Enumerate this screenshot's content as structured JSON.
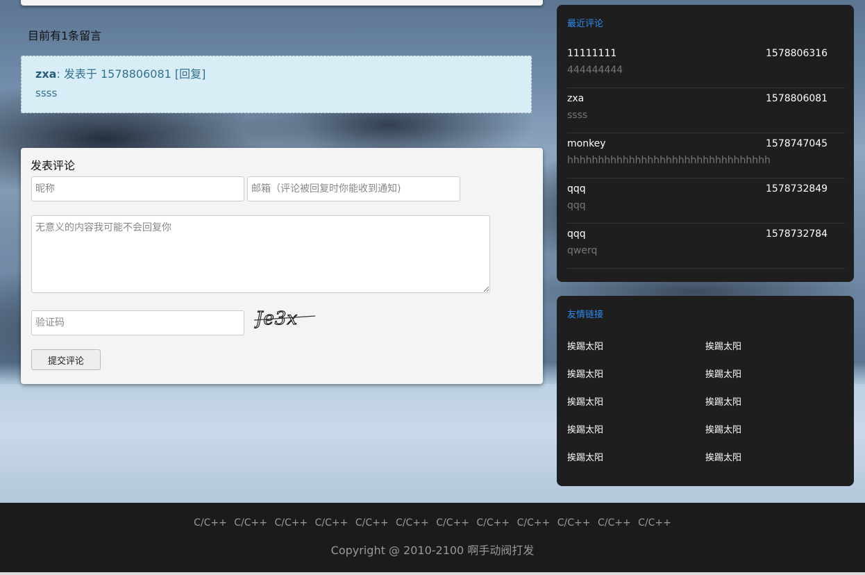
{
  "message_count_text": "目前有1条留言",
  "comment": {
    "author": "zxa",
    "meta": ": 发表于 1578806081 [回复]",
    "body": "ssss"
  },
  "form": {
    "title": "发表评论",
    "nickname_placeholder": "昵称",
    "email_placeholder": "邮箱（评论被回复时你能收到通知)",
    "content_placeholder": "无意义的内容我可能不会回复你",
    "captcha_placeholder": "验证码",
    "captcha_text": "Je3x",
    "submit_label": "提交评论"
  },
  "recent": {
    "title": "最近评论",
    "items": [
      {
        "name": "11111111",
        "time": "1578806316",
        "text": "444444444"
      },
      {
        "name": "zxa",
        "time": "1578806081",
        "text": "ssss"
      },
      {
        "name": "monkey",
        "time": "1578747045",
        "text": "hhhhhhhhhhhhhhhhhhhhhhhhhhhhhhhhh"
      },
      {
        "name": "qqq",
        "time": "1578732849",
        "text": "qqq"
      },
      {
        "name": "qqq",
        "time": "1578732784",
        "text": "qwerq"
      }
    ]
  },
  "links": {
    "title": "友情链接",
    "items": [
      "挨踢太阳",
      "挨踢太阳",
      "挨踢太阳",
      "挨踢太阳",
      "挨踢太阳",
      "挨踢太阳",
      "挨踢太阳",
      "挨踢太阳",
      "挨踢太阳",
      "挨踢太阳"
    ]
  },
  "footer": {
    "links": [
      "C/C++",
      "C/C++",
      "C/C++",
      "C/C++",
      "C/C++",
      "C/C++",
      "C/C++",
      "C/C++",
      "C/C++",
      "C/C++",
      "C/C++",
      "C/C++"
    ],
    "copyright": "Copyright @ 2010-2100 啊手动阀打发"
  },
  "colors": {
    "panel_bg": "#1e1e1e",
    "accent": "#2d8cf0",
    "comment_bg": "#d9edf7",
    "footer_bg": "#1b1b1b"
  }
}
